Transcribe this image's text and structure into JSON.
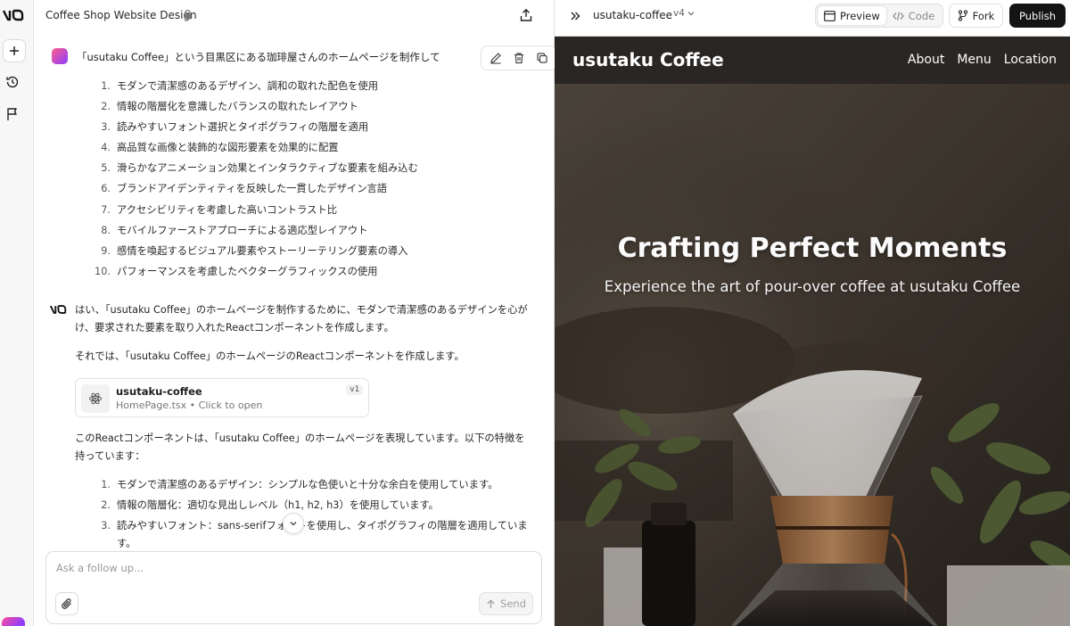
{
  "sidebar": {
    "logo_icon": "v0-logo-icon",
    "new_chat_icon": "plus-icon",
    "history_icon": "clock-history-icon",
    "flag_icon": "flag-icon",
    "avatar_icon": "user-avatar-icon"
  },
  "chat": {
    "title": "Coffee Shop Website Design",
    "user_message": "「usutaku Coffee」という目黒区にある珈琲屋さんのホームページを制作して",
    "requirements": [
      {
        "num": "1.",
        "text": "モダンで清潔感のあるデザイン、調和の取れた配色を使用"
      },
      {
        "num": "2.",
        "text": "情報の階層化を意識したバランスの取れたレイアウト"
      },
      {
        "num": "3.",
        "text": "読みやすいフォント選択とタイポグラフィの階層を適用"
      },
      {
        "num": "4.",
        "text": "高品質な画像と装飾的な図形要素を効果的に配置"
      },
      {
        "num": "5.",
        "text": "滑らかなアニメーション効果とインタラクティブな要素を組み込む"
      },
      {
        "num": "6.",
        "text": "ブランドアイデンティティを反映した一貫したデザイン言語"
      },
      {
        "num": "7.",
        "text": "アクセシビリティを考慮した高いコントラスト比"
      },
      {
        "num": "8.",
        "text": "モバイルファーストアプローチによる適応型レイアウト"
      },
      {
        "num": "9.",
        "text": "感情を喚起するビジュアル要素やストーリーテリング要素の導入"
      },
      {
        "num": "10.",
        "text": "パフォーマンスを考慮したベクターグラフィックスの使用"
      }
    ],
    "ai_paragraph_1": "はい、「usutaku Coffee」のホームページを制作するために、モダンで清潔感のあるデザインを心がけ、要求された要素を取り入れたReactコンポーネントを作成します。",
    "ai_paragraph_2": "それでは、「usutaku Coffee」のホームページのReactコンポーネントを作成します。",
    "file_card": {
      "name": "usutaku-coffee",
      "subtitle": "HomePage.tsx • Click to open",
      "version": "v1"
    },
    "ai_paragraph_3": "このReactコンポーネントは、「usutaku Coffee」のホームページを表現しています。以下の特徴を持っています：",
    "features": [
      {
        "num": "1.",
        "text": "モダンで清潔感のあるデザイン：シンプルな色使いと十分な余白を使用しています。"
      },
      {
        "num": "2.",
        "text": "情報の階層化：適切な見出しレベル（h1, h2, h3）を使用しています。"
      },
      {
        "num": "3.",
        "text": "読みやすいフォント：sans-serifフォントを使用し、タイポグラフィの階層を適用しています。"
      }
    ],
    "input_placeholder": "Ask a follow up...",
    "send_label": "Send"
  },
  "preview": {
    "project_name": "usutaku-coffee",
    "version": "v4",
    "tab_preview": "Preview",
    "tab_code": "Code",
    "fork_label": "Fork",
    "publish_label": "Publish",
    "site": {
      "brand": "usutaku Coffee",
      "nav": [
        "About",
        "Menu",
        "Location"
      ],
      "hero_title": "Crafting Perfect Moments",
      "hero_subtitle": "Experience the art of pour-over coffee at usutaku Coffee"
    }
  },
  "colors": {
    "publish_bg": "#141414",
    "site_nav_bg": "#2a2623",
    "hero_bg": "#3b342d"
  }
}
